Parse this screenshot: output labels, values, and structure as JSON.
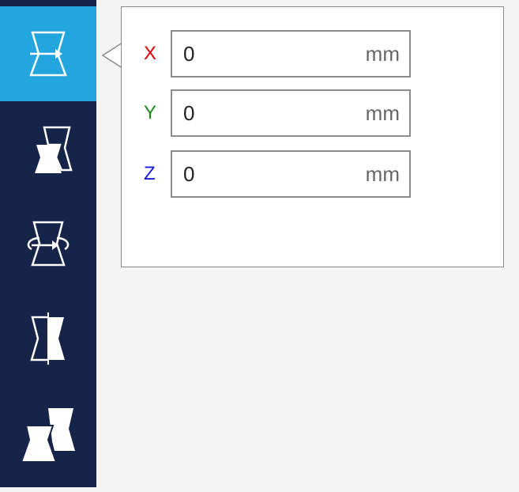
{
  "toolbar": {
    "tools": [
      {
        "name": "move",
        "icon": "move-tool-icon",
        "active": true
      },
      {
        "name": "scale",
        "icon": "scale-tool-icon",
        "active": false
      },
      {
        "name": "rotate",
        "icon": "rotate-tool-icon",
        "active": false
      },
      {
        "name": "mirror",
        "icon": "mirror-tool-icon",
        "active": false
      },
      {
        "name": "per-model-settings",
        "icon": "per-model-settings-icon",
        "active": false
      }
    ],
    "active_color": "#23a6dd",
    "background_color": "#16244a"
  },
  "move_panel": {
    "x": {
      "label": "X",
      "value": "0",
      "unit": "mm",
      "color": "#e00000"
    },
    "y": {
      "label": "Y",
      "value": "0",
      "unit": "mm",
      "color": "#1a8a1a"
    },
    "z": {
      "label": "Z",
      "value": "0",
      "unit": "mm",
      "color": "#1a1ad6"
    }
  }
}
